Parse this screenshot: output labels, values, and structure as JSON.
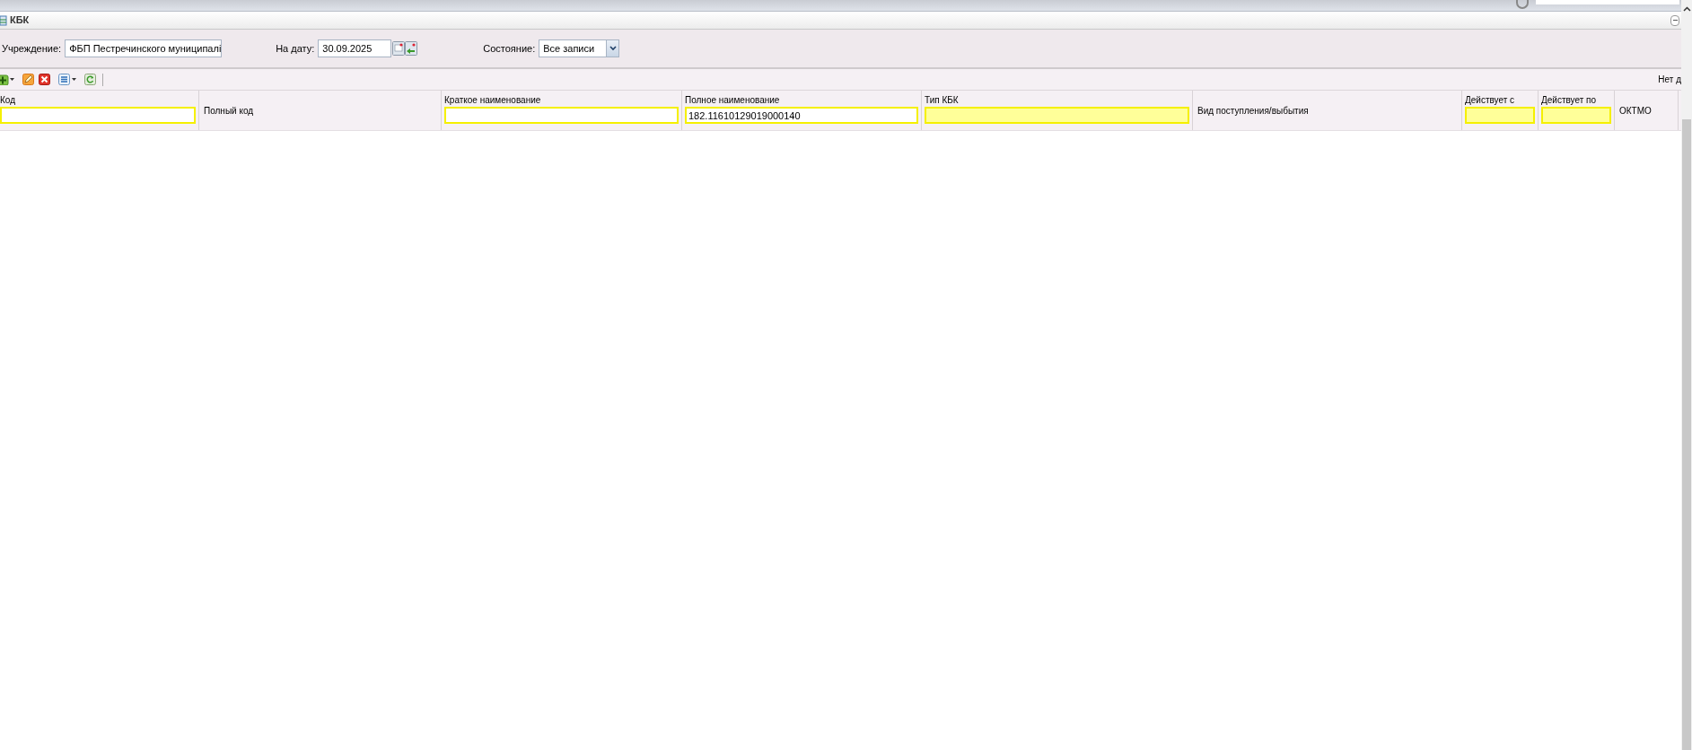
{
  "window": {
    "title": "КБК"
  },
  "filters": [
    {
      "kind": "text",
      "label": "Учреждение:",
      "value": "ФБП Пестречинского муниципалі"
    },
    {
      "kind": "date",
      "label": "На дату:",
      "value": "30.09.2025"
    },
    {
      "kind": "select",
      "label": "Состояние:",
      "value": "Все записи"
    }
  ],
  "toolbar": {
    "status_text": "Нет д"
  },
  "table": {
    "columns": [
      {
        "label": "Код",
        "filter": {
          "kind": "text"
        }
      },
      {
        "label": "Полный код"
      },
      {
        "label": "Краткое наименование",
        "filter": {
          "kind": "text"
        }
      },
      {
        "label": "Полное наименование",
        "filter": {
          "kind": "text",
          "value": "182.11610129019000140"
        }
      },
      {
        "label": "Тип КБК",
        "filter": {
          "kind": "select"
        }
      },
      {
        "label": "Вид поступления/выбытия"
      },
      {
        "label": "Действует с",
        "filter": {
          "kind": "date"
        }
      },
      {
        "label": "Действует по",
        "filter": {
          "kind": "date"
        }
      },
      {
        "label": "ОКТМО"
      }
    ]
  }
}
